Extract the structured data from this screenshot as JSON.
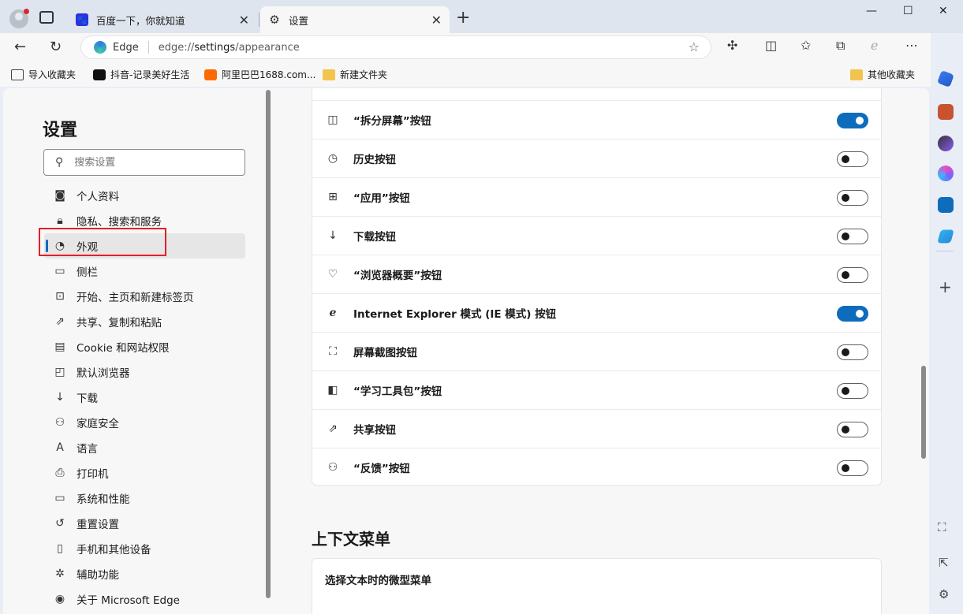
{
  "tabs": [
    {
      "title": "百度一下，你就知道",
      "icon": "baidu-icon"
    },
    {
      "title": "设置",
      "icon": "gear-icon"
    }
  ],
  "toolbar": {
    "brand": "Edge",
    "url_prefix": "edge://",
    "url_host": "settings",
    "url_path": "/appearance"
  },
  "favorites": [
    {
      "label": "导入收藏夹",
      "icon": "import-icon"
    },
    {
      "label": "抖音-记录美好生活",
      "icon": "douyin-icon"
    },
    {
      "label": "阿里巴巴1688.com...",
      "icon": "alibaba-icon"
    },
    {
      "label": "新建文件夹",
      "icon": "folder-icon"
    },
    {
      "label": "其他收藏夹",
      "icon": "folder-icon"
    }
  ],
  "settings": {
    "title": "设置",
    "search_placeholder": "搜索设置",
    "nav": [
      {
        "label": "个人资料",
        "icon": "profile-icon"
      },
      {
        "label": "隐私、搜索和服务",
        "icon": "lock-icon"
      },
      {
        "label": "外观",
        "icon": "palette-icon",
        "active": true
      },
      {
        "label": "侧栏",
        "icon": "sidebar-icon"
      },
      {
        "label": "开始、主页和新建标签页",
        "icon": "home-icon"
      },
      {
        "label": "共享、复制和粘贴",
        "icon": "share-icon"
      },
      {
        "label": "Cookie 和网站权限",
        "icon": "cookie-icon"
      },
      {
        "label": "默认浏览器",
        "icon": "browser-icon"
      },
      {
        "label": "下载",
        "icon": "download-icon"
      },
      {
        "label": "家庭安全",
        "icon": "family-icon"
      },
      {
        "label": "语言",
        "icon": "language-icon"
      },
      {
        "label": "打印机",
        "icon": "printer-icon"
      },
      {
        "label": "系统和性能",
        "icon": "laptop-icon"
      },
      {
        "label": "重置设置",
        "icon": "reset-icon"
      },
      {
        "label": "手机和其他设备",
        "icon": "phone-icon"
      },
      {
        "label": "辅助功能",
        "icon": "accessibility-icon"
      },
      {
        "label": "关于 Microsoft Edge",
        "icon": "edge-icon"
      }
    ]
  },
  "toolbar_buttons": [
    {
      "label": "“拆分屏幕”按钮",
      "icon": "split-screen-icon",
      "on": true
    },
    {
      "label": "历史按钮",
      "icon": "history-icon",
      "on": false
    },
    {
      "label": "“应用”按钮",
      "icon": "apps-icon",
      "on": false
    },
    {
      "label": "下载按钮",
      "icon": "download-icon",
      "on": false
    },
    {
      "label": "“浏览器概要”按钮",
      "icon": "heartbeat-icon",
      "on": false
    },
    {
      "label": "Internet Explorer 模式 (IE 模式) 按钮",
      "icon": "ie-icon",
      "on": true
    },
    {
      "label": "屏幕截图按钮",
      "icon": "screenshot-icon",
      "on": false
    },
    {
      "label": "“学习工具包”按钮",
      "icon": "learning-icon",
      "on": false
    },
    {
      "label": "共享按钮",
      "icon": "share-icon",
      "on": false
    },
    {
      "label": "“反馈”按钮",
      "icon": "feedback-icon",
      "on": false
    }
  ],
  "context_menu": {
    "title": "上下文菜单",
    "subtitle": "选择文本时的微型菜单"
  },
  "colors": {
    "accent": "#0f6cbd",
    "highlight": "#e0212b"
  }
}
